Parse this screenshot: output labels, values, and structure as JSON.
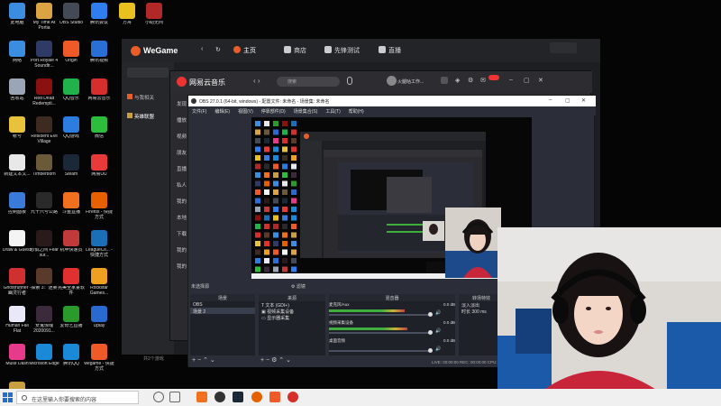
{
  "desktop": {
    "icons": [
      {
        "label": "此电脑",
        "color": "#3b8de0"
      },
      {
        "label": "My Time At Portia",
        "color": "#d9a441"
      },
      {
        "label": "OBS Studio",
        "color": "#444a55"
      },
      {
        "label": "腾讯会议",
        "color": "#2f7ef0"
      },
      {
        "label": "方舟",
        "color": "#e8c020"
      },
      {
        "label": "小助无间",
        "color": "#b02828"
      },
      {
        "label": "网络",
        "color": "#3b8de0"
      },
      {
        "label": "Port Royale 4 Soundtr...",
        "color": "#2f3a66"
      },
      {
        "label": "Origin",
        "color": "#f05a28"
      },
      {
        "label": "腾讯视频",
        "color": "#2a6fd6"
      },
      {
        "label": "回收站",
        "color": "#9aa5b5"
      },
      {
        "label": "Red Dead Redempti...",
        "color": "#8b1010"
      },
      {
        "label": "QQ音乐",
        "color": "#22b24c"
      },
      {
        "label": "网易云音乐",
        "color": "#d62d2d"
      },
      {
        "label": "帐号",
        "color": "#e8c23a"
      },
      {
        "label": "Resident Evil Village",
        "color": "#3d2a20"
      },
      {
        "label": "QQ游戏",
        "color": "#2b7de0"
      },
      {
        "label": "微信",
        "color": "#2bbd3b"
      },
      {
        "label": "新建文本文...",
        "color": "#e8e8e8"
      },
      {
        "label": "Timberborn",
        "color": "#6a5a3a"
      },
      {
        "label": "Steam",
        "color": "#1b2838"
      },
      {
        "label": "网易UU",
        "color": "#e83a3a"
      },
      {
        "label": "控制面板",
        "color": "#3a7ad8"
      },
      {
        "label": "九十六号公路",
        "color": "#2a2a2a"
      },
      {
        "label": "斗鱼直播",
        "color": "#f07020"
      },
      {
        "label": "Firefox - 快捷方式",
        "color": "#e66000"
      },
      {
        "label": "Draw & Guess",
        "color": "#f4f4f4"
      },
      {
        "label": "恐惧之间 Fear sur...",
        "color": "#2a1a1a"
      },
      {
        "label": "机甲快递员",
        "color": "#c03a3a"
      },
      {
        "label": "LeagueCli... - 快捷方式",
        "color": "#1a6fb8"
      },
      {
        "label": "Ghostrunner - 幽灵行者",
        "color": "#d03030"
      },
      {
        "label": "探索 3：迷雾",
        "color": "#5a3a2a"
      },
      {
        "label": "完美全家宴软件",
        "color": "#e03030"
      },
      {
        "label": "Rockstar Games...",
        "color": "#f0a020"
      },
      {
        "label": "Human Fall Flat",
        "color": "#e8e8f8"
      },
      {
        "label": "女鬼惊魂 2020091...",
        "color": "#3a2a3a"
      },
      {
        "label": "爱奇艺直播",
        "color": "#2a9a2a"
      },
      {
        "label": "Uplay",
        "color": "#2a6ad0"
      },
      {
        "label": "Muse Dash",
        "color": "#e83a8a"
      },
      {
        "label": "Microsoft Edge",
        "color": "#1a8ad8"
      },
      {
        "label": "腾讯QQ",
        "color": "#1a8ad8"
      },
      {
        "label": "wegame - 快捷方式",
        "color": "#f05a28"
      },
      {
        "label": "英雄联盟 WeGame版",
        "color": "#c8a040"
      }
    ]
  },
  "taskbar": {
    "search_placeholder": "在这里输入你要搜索的内容",
    "apps": [
      "obs",
      "steam",
      "wegame",
      "firefox",
      "netease"
    ]
  },
  "wegame": {
    "title": "WeGame",
    "nav": [
      "主页",
      "商店",
      "先锋测试",
      "直播"
    ],
    "sidebar": [
      "全部游戏",
      "与我相关",
      "英雄联盟"
    ],
    "recent": "共2个游戏"
  },
  "music": {
    "title": "网易云音乐",
    "search_placeholder": "搜索",
    "user": "火腿咕工作...",
    "side_items": [
      "发现",
      "播放",
      "视频",
      "朋友",
      "直播",
      "私人",
      "我的",
      "本地",
      "下载",
      "我的",
      "我的"
    ]
  },
  "obs": {
    "title": "OBS 27.0.1 (64-bit, windows) - 配置文件: 未命名 - 场景集: 未命名",
    "menu": [
      "文件(F)",
      "编辑(E)",
      "视图(V)",
      "停靠部件(D)",
      "场景集合(S)",
      "工具(T)",
      "帮助(H)"
    ],
    "no_source": "未选择源",
    "filters_label": "滤镜",
    "docks": {
      "scenes": {
        "header": "场景",
        "items": [
          "OBS",
          "场景 2"
        ]
      },
      "sources": {
        "header": "来源",
        "items": [
          "文本 (GDI+)",
          "视频采集设备",
          "显示器采集"
        ]
      },
      "mixer": {
        "header": "混音器",
        "channels": [
          {
            "name": "麦克风/Aux",
            "db": "0.0 dB",
            "level": 0.75
          },
          {
            "name": "视频采集设备",
            "db": "0.0 dB",
            "level": 0.78
          },
          {
            "name": "桌面音频",
            "db": "0.0 dB",
            "level": 0.0
          }
        ]
      },
      "transitions": {
        "header": "转场特效",
        "items": [
          "淡入淡出",
          "时长 300 ms"
        ]
      }
    },
    "status": "LIVE: 00:00:00   REC: 00:00:00   CPU: 4.0%, 30.00 fps"
  },
  "colors": {
    "wegame_accent": "#e85d2a",
    "netease_red": "#e33333",
    "obs_bg": "#2b2e38"
  }
}
